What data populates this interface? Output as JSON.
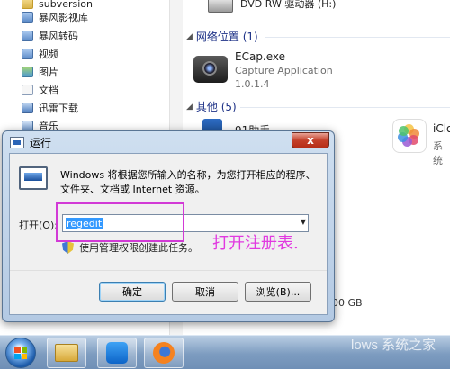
{
  "nav": {
    "items": [
      {
        "label": "subversion",
        "icon": "folder-icon"
      },
      {
        "label": "暴风影视库",
        "icon": "library-icon"
      },
      {
        "label": "暴风转码",
        "icon": "library-icon"
      },
      {
        "label": "视频",
        "icon": "video-icon"
      },
      {
        "label": "图片",
        "icon": "picture-icon"
      },
      {
        "label": "文档",
        "icon": "document-icon"
      },
      {
        "label": "迅雷下载",
        "icon": "download-icon"
      },
      {
        "label": "音乐",
        "icon": "music-icon"
      }
    ]
  },
  "content": {
    "dvd_label": "DVD RW 驱动器 (H:)",
    "network_group": "网络位置 (1)",
    "ecap": {
      "name": "ECap.exe",
      "description": "Capture Application",
      "version": "1.0.1.4"
    },
    "other_group": "其他 (5)",
    "phone_label": "91助手",
    "icloud_label": "iClo",
    "icloud_sub": "系统",
    "size_text": "00 GB"
  },
  "run_dialog": {
    "title": "运行",
    "close_symbol": "x",
    "description": "Windows 将根据您所输入的名称，为您打开相应的程序、文件夹、文档或 Internet 资源。",
    "open_label": "打开(O):",
    "open_value": "regedit",
    "admin_note": "使用管理权限创建此任务。",
    "ok_label": "确定",
    "cancel_label": "取消",
    "browse_label": "浏览(B)..."
  },
  "annotation": {
    "text": "打开注册表.",
    "color": "#e13ae0"
  },
  "taskbar": {
    "watermark": "lows 系统之家",
    "apps": [
      "start-orb",
      "explorer",
      "blue-app",
      "firefox"
    ]
  },
  "colors": {
    "group_head": "#1e3287",
    "selection": "#3399ff",
    "highlight": "#d23ad6"
  }
}
